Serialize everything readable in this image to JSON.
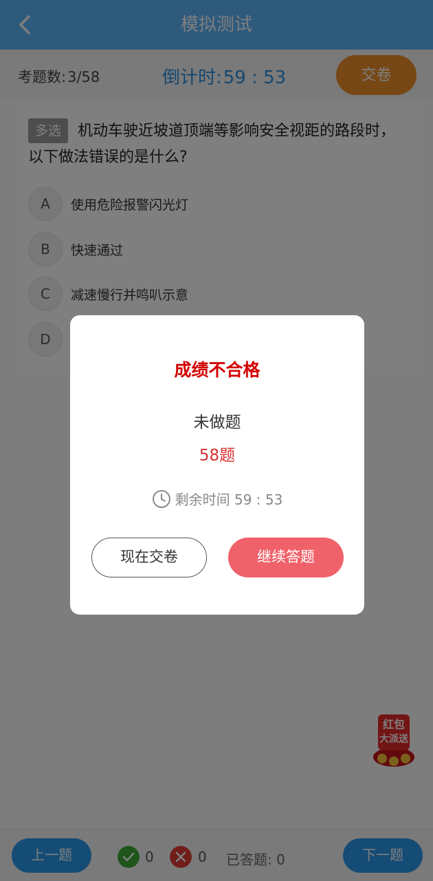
{
  "header": {
    "title": "模拟测试"
  },
  "info": {
    "count_label": "考题数:",
    "count_value": "3/58",
    "timer_label": "倒计时:",
    "timer_value": "59 : 53",
    "submit_label": "交卷"
  },
  "question": {
    "tag": "多选",
    "text": "机动车驶近坡道顶端等影响安全视距的路段时，以下做法错误的是什么?",
    "options": [
      {
        "letter": "A",
        "text": "使用危险报警闪光灯"
      },
      {
        "letter": "B",
        "text": "快速通过"
      },
      {
        "letter": "C",
        "text": "减速慢行并鸣叭示意"
      },
      {
        "letter": "D",
        "text": ""
      }
    ]
  },
  "bottom": {
    "prev_label": "上一题",
    "next_label": "下一题",
    "correct_count": "0",
    "wrong_count": "0",
    "answered_label": "已答题:",
    "answered_value": "0"
  },
  "promo": {
    "line1": "红包",
    "line2": "大派送"
  },
  "modal": {
    "title": "成绩不合格",
    "unanswered_label": "未做题",
    "unanswered_count": "58题",
    "remaining_label": "剩余时间",
    "remaining_value": "59 : 53",
    "submit_now_label": "现在交卷",
    "continue_label": "继续答题"
  },
  "colors": {
    "header": "#5cb4f8",
    "timer": "#2b8fe0",
    "submit": "#ef8f2a",
    "fail": "#d40000",
    "continue": "#f0626a",
    "correct": "#3aaa35",
    "wrong": "#e23a32"
  }
}
